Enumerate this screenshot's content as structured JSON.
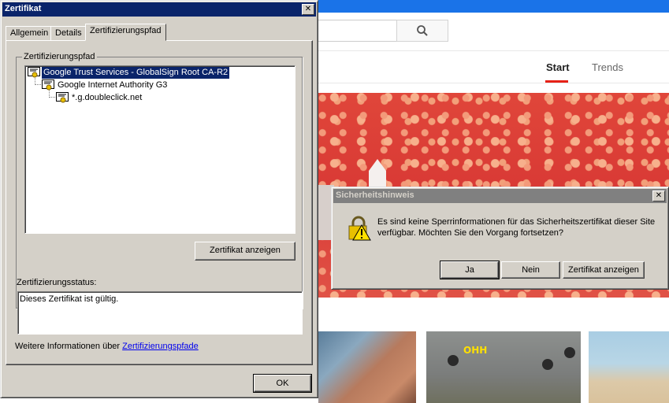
{
  "browser": {
    "nav_tabs": [
      {
        "label": "Start"
      },
      {
        "label": "Trends"
      }
    ],
    "thumbnail_caption": "OHH"
  },
  "cert_dialog": {
    "title": "Zertifikat",
    "close_symbol": "✕",
    "tabs": [
      {
        "label": "Allgemein"
      },
      {
        "label": "Details"
      },
      {
        "label": "Zertifizierungspfad"
      }
    ],
    "path_group_label": "Zertifizierungspfad",
    "path_tree": [
      {
        "label": "Google Trust Services - GlobalSign Root CA-R2",
        "selected": true
      },
      {
        "label": "Google Internet Authority G3",
        "selected": false
      },
      {
        "label": "*.g.doubleclick.net",
        "selected": false
      }
    ],
    "view_cert_button": "Zertifikat anzeigen",
    "status_label": "Zertifizierungsstatus:",
    "status_text": "Dieses Zertifikat ist gültig.",
    "more_info_prefix": "Weitere Informationen über",
    "more_info_link": "Zertifizierungspfade",
    "ok_button": "OK"
  },
  "security_dialog": {
    "title": "Sicherheitshinweis",
    "close_symbol": "✕",
    "message": "Es sind keine Sperrinformationen für das Sicherheitszertifikat dieser Site verfügbar. Möchten Sie den Vorgang fortsetzen?",
    "buttons": {
      "yes": "Ja",
      "no": "Nein",
      "view_cert": "Zertifikat anzeigen"
    }
  },
  "colors": {
    "titlebar_active": "#0a246a",
    "titlebar_inactive": "#808080",
    "dialog_face": "#d4d0c8",
    "link": "#0000ee",
    "yt_accent": "#e62117"
  }
}
